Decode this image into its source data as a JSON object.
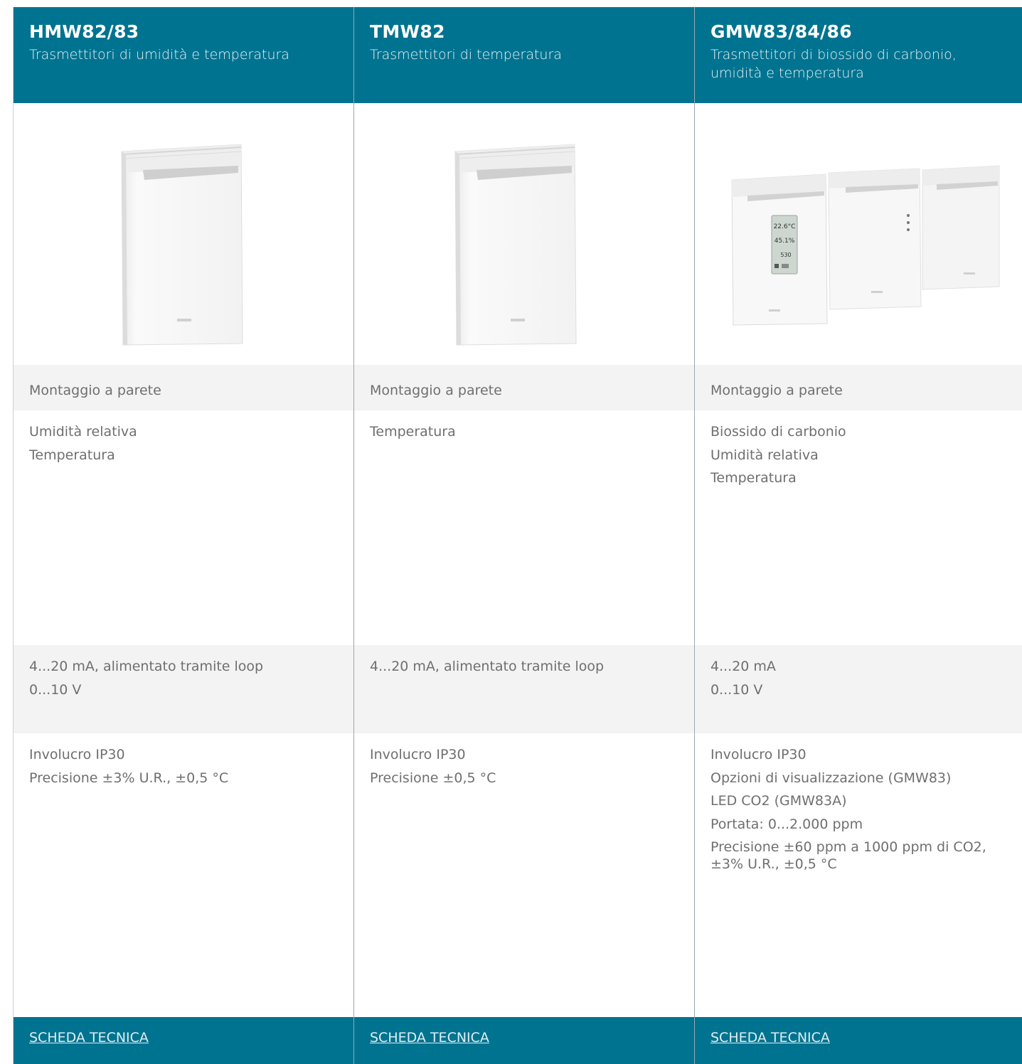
{
  "columns": [
    {
      "title": "HMW82/83",
      "subtitle": "Trasmettitori di umidità e temperatura",
      "image_icon": "wall-transmitter-icon",
      "mounting": "Montaggio a parete",
      "measures": [
        "Umidità relativa",
        "Temperatura"
      ],
      "outputs": [
        "4...20 mA, alimentato tramite loop",
        "0...10 V"
      ],
      "features": [
        "Involucro IP30",
        "Precisione ±3% U.R., ±0,5 °C"
      ],
      "link": "SCHEDA TECNICA"
    },
    {
      "title": "TMW82",
      "subtitle": "Trasmettitori di temperatura",
      "image_icon": "wall-transmitter-icon",
      "mounting": "Montaggio a parete",
      "measures": [
        "Temperatura"
      ],
      "outputs": [
        "4...20 mA, alimentato tramite loop"
      ],
      "features": [
        "Involucro IP30",
        "Precisione ±0,5 °C"
      ],
      "link": "SCHEDA TECNICA"
    },
    {
      "title": "GMW83/84/86",
      "subtitle": "Trasmettitori di biossido di carbonio, umidità e temperatura",
      "image_icon": "transmitter-group-icon",
      "display": {
        "temp": "22.6°C",
        "rh": "45.1%",
        "co2": "530"
      },
      "mounting": "Montaggio a parete",
      "measures": [
        "Biossido di carbonio",
        "Umidità relativa",
        "Temperatura"
      ],
      "outputs": [
        "4...20 mA",
        "0...10 V"
      ],
      "features": [
        "Involucro IP30",
        "Opzioni di visualizzazione (GMW83)",
        "LED CO2 (GMW83A)",
        "Portata: 0...2.000 ppm",
        "Precisione ±60 ppm a 1000 ppm di CO2, ±3% U.R., ±0,5 °C"
      ],
      "link": "SCHEDA TECNICA"
    }
  ],
  "colors": {
    "header": "#007390",
    "row_alt": "#f3f3f3",
    "text": "#6f6f6f"
  }
}
